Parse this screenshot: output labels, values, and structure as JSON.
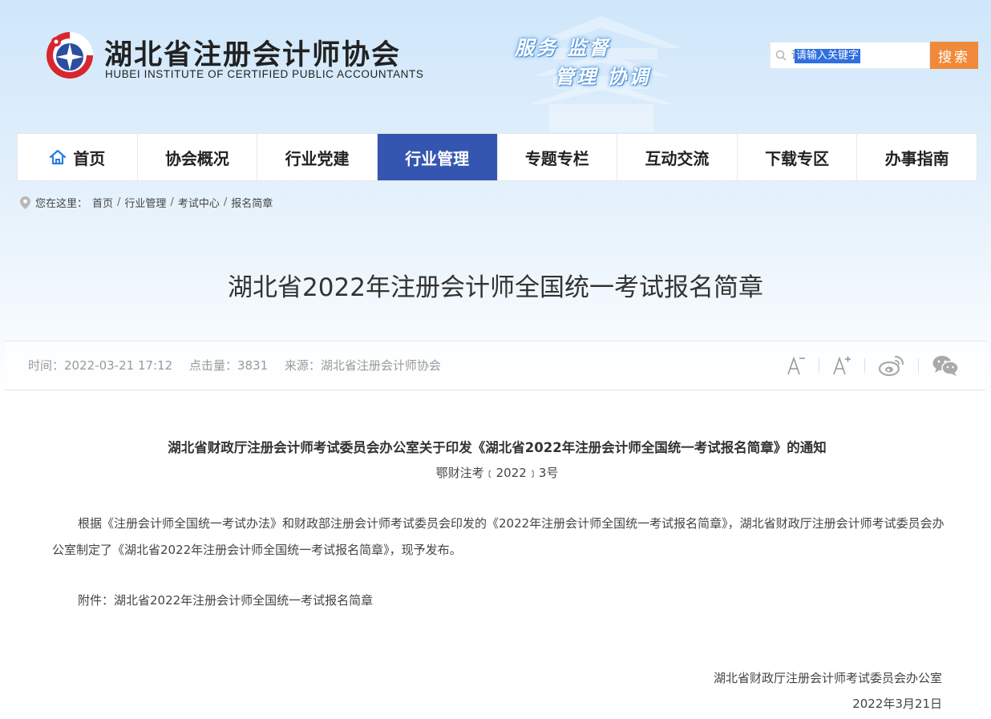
{
  "header": {
    "site_name_cn": "湖北省注册会计师协会",
    "site_name_en": "HUBEI INSTITUTE OF CERTIFIED PUBLIC ACCOUNTANTS",
    "slogan_line1": "服务 监督",
    "slogan_line2": "管理 协调",
    "search": {
      "placeholder": "请输入关键字",
      "button": "搜索"
    }
  },
  "nav": {
    "items": [
      {
        "label": "首页",
        "icon": "home-icon"
      },
      {
        "label": "协会概况"
      },
      {
        "label": "行业党建"
      },
      {
        "label": "行业管理",
        "active": true
      },
      {
        "label": "专题专栏"
      },
      {
        "label": "互动交流"
      },
      {
        "label": "下载专区"
      },
      {
        "label": "办事指南"
      }
    ]
  },
  "breadcrumb": {
    "prefix": "您在这里：",
    "items": [
      "首页",
      "行业管理",
      "考试中心",
      "报名简章"
    ]
  },
  "article": {
    "title": "湖北省2022年注册会计师全国统一考试报名简章",
    "meta": {
      "time": "时间：2022-03-21 17:12",
      "views": "点击量：3831",
      "source": "来源：湖北省注册会计师协会"
    },
    "doc_title": "湖北省财政厅注册会计师考试委员会办公室关于印发《湖北省2022年注册会计师全国统一考试报名简章》的通知",
    "doc_number": "鄂财注考﹝2022﹞3号",
    "paragraph1": "根据《注册会计师全国统一考试办法》和财政部注册会计师考试委员会印发的《2022年注册会计师全国统一考试报名简章》，湖北省财政厅注册会计师考试委员会办公室制定了《湖北省2022年注册会计师全国统一考试报名简章》，现予发布。",
    "paragraph2": "附件：湖北省2022年注册会计师全国统一考试报名简章",
    "signature_org": "湖北省财政厅注册会计师考试委员会办公室",
    "signature_date": "2022年3月21日"
  },
  "colors": {
    "nav_active": "#3556b0",
    "search_button": "#f08a3a",
    "logo_red": "#d8262f",
    "logo_blue": "#2b4ea0"
  }
}
